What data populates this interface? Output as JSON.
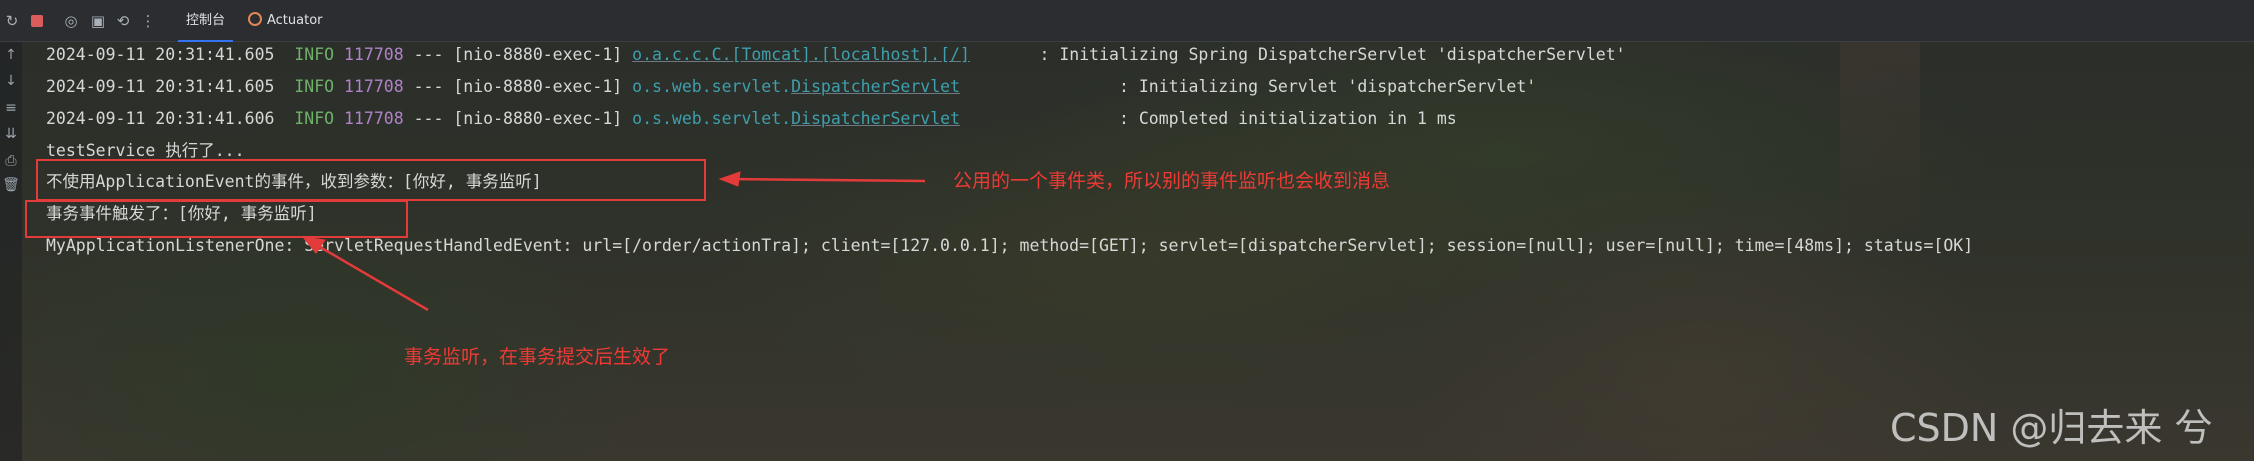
{
  "toolbar": {
    "tabs": [
      {
        "label": "控制台",
        "active": true
      },
      {
        "label": "Actuator",
        "active": false,
        "icon": "actuator-icon"
      }
    ],
    "icons": [
      "rerun-icon",
      "stop-icon",
      "camera-icon",
      "export-icon",
      "restore-icon",
      "more-icon"
    ]
  },
  "gutter_icons": [
    "up-arrow-icon",
    "down-arrow-icon",
    "soft-wrap-icon",
    "scroll-to-end-icon",
    "print-icon",
    "trash-icon"
  ],
  "log_lines": [
    {
      "timestamp": "2024-09-11 20:31:41.605",
      "level": "INFO",
      "pid": "117708",
      "sep": "---",
      "thread": "[nio-8880-exec-1]",
      "logger": "o.a.c.c.C.[Tomcat].[localhost].[/]",
      "message": ": Initializing Spring DispatcherServlet 'dispatcherServlet'"
    },
    {
      "timestamp": "2024-09-11 20:31:41.605",
      "level": "INFO",
      "pid": "117708",
      "sep": "---",
      "thread": "[nio-8880-exec-1]",
      "logger_prefix": "o.s.web.servlet.",
      "logger_class": "DispatcherServlet",
      "message": ": Initializing Servlet 'dispatcherServlet'"
    },
    {
      "timestamp": "2024-09-11 20:31:41.606",
      "level": "INFO",
      "pid": "117708",
      "sep": "---",
      "thread": "[nio-8880-exec-1]",
      "logger_prefix": "o.s.web.servlet.",
      "logger_class": "DispatcherServlet",
      "message": ": Completed initialization in 1 ms"
    }
  ],
  "plain_lines": [
    "testService 执行了...",
    "不使用ApplicationEvent的事件，收到参数：[你好, 事务监听]",
    "事务事件触发了：[你好, 事务监听]",
    "MyApplicationListenerOne: ServletRequestHandledEvent: url=[/order/actionTra]; client=[127.0.0.1]; method=[GET]; servlet=[dispatcherServlet]; session=[null]; user=[null]; time=[48ms]; status=[OK]"
  ],
  "annotations": {
    "note_top": "公用的一个事件类，所以别的事件监听也会收到消息",
    "note_bottom": "事务监听，在事务提交后生效了",
    "color": "#e33a3a"
  },
  "watermark": "CSDN @归去来 兮",
  "colors": {
    "info": "#6fb06a",
    "pid": "#b083c9",
    "logger": "#3e9fae",
    "text": "#d6d8d6",
    "tab_underline": "#3574f0"
  }
}
